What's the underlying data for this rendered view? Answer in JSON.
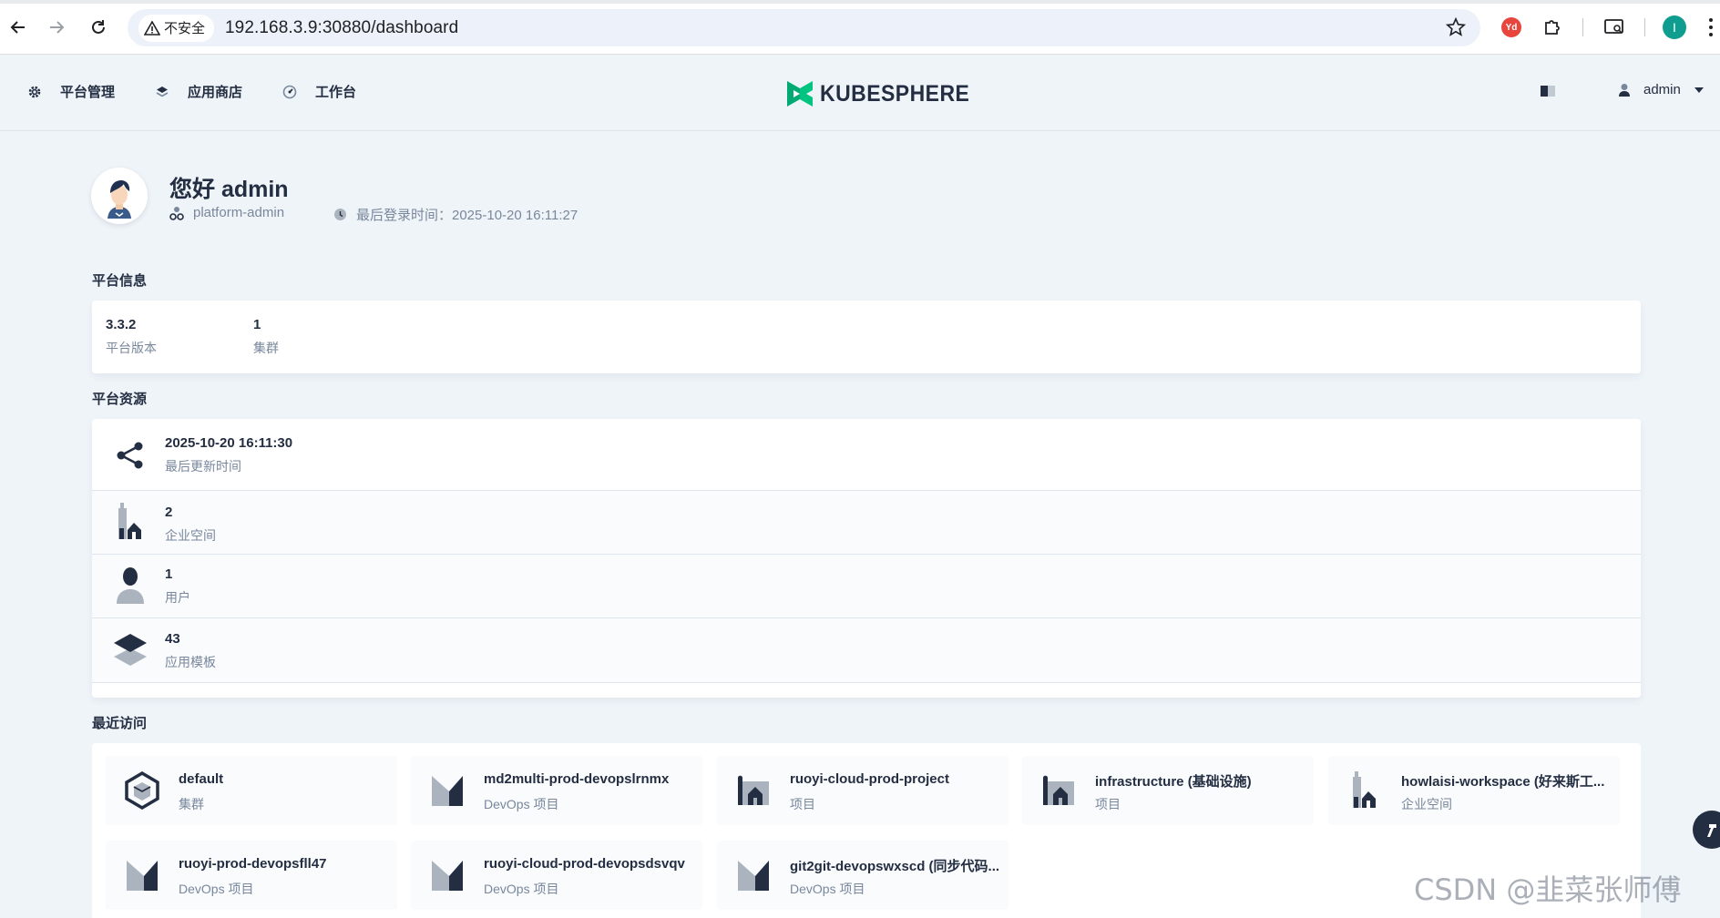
{
  "browser": {
    "security_label": "不安全",
    "url": "192.168.3.9:30880/dashboard",
    "extension_badge": "Yd",
    "profile_initial": "I"
  },
  "header": {
    "nav": [
      {
        "label": "平台管理",
        "icon": "gear-icon"
      },
      {
        "label": "应用商店",
        "icon": "appstore-icon"
      },
      {
        "label": "工作台",
        "icon": "dashboard-icon"
      }
    ],
    "logo_text": "KUBESPHERE",
    "user": "admin"
  },
  "greeting": {
    "title": "您好 admin",
    "role": "platform-admin",
    "last_login": "最后登录时间：2025-10-20 16:11:27"
  },
  "platform_info": {
    "title": "平台信息",
    "items": [
      {
        "value": "3.3.2",
        "label": "平台版本"
      },
      {
        "value": "1",
        "label": "集群"
      }
    ]
  },
  "platform_resources": {
    "title": "平台资源",
    "rows": [
      {
        "value": "2025-10-20 16:11:30",
        "label": "最后更新时间",
        "icon": "share-nodes-icon"
      },
      {
        "value": "2",
        "label": "企业空间",
        "icon": "workspace-icon"
      },
      {
        "value": "1",
        "label": "用户",
        "icon": "user-icon"
      },
      {
        "value": "43",
        "label": "应用模板",
        "icon": "app-template-icon"
      }
    ]
  },
  "recent": {
    "title": "最近访问",
    "items": [
      {
        "name": "default",
        "type": "集群",
        "icon": "cluster-icon"
      },
      {
        "name": "md2multi-prod-devopslrnmx",
        "type": "DevOps 项目",
        "icon": "devops-icon"
      },
      {
        "name": "ruoyi-cloud-prod-project",
        "type": "项目",
        "icon": "project-icon"
      },
      {
        "name": "infrastructure (基础设施)",
        "type": "项目",
        "icon": "project-icon"
      },
      {
        "name": "howlaisi-workspace (好来斯工...",
        "type": "企业空间",
        "icon": "workspace-icon"
      },
      {
        "name": "ruoyi-prod-devopsfll47",
        "type": "DevOps 项目",
        "icon": "devops-icon"
      },
      {
        "name": "ruoyi-cloud-prod-devopsdsvqv",
        "type": "DevOps 项目",
        "icon": "devops-icon"
      },
      {
        "name": "git2git-devopswxscd (同步代码...",
        "type": "DevOps 项目",
        "icon": "devops-icon"
      }
    ]
  },
  "watermark": "CSDN @韭菜张师傅",
  "colors": {
    "background": "#eff4f9",
    "text_primary": "#242e42",
    "text_secondary": "#79879c",
    "brand_green": "#00aa72"
  }
}
